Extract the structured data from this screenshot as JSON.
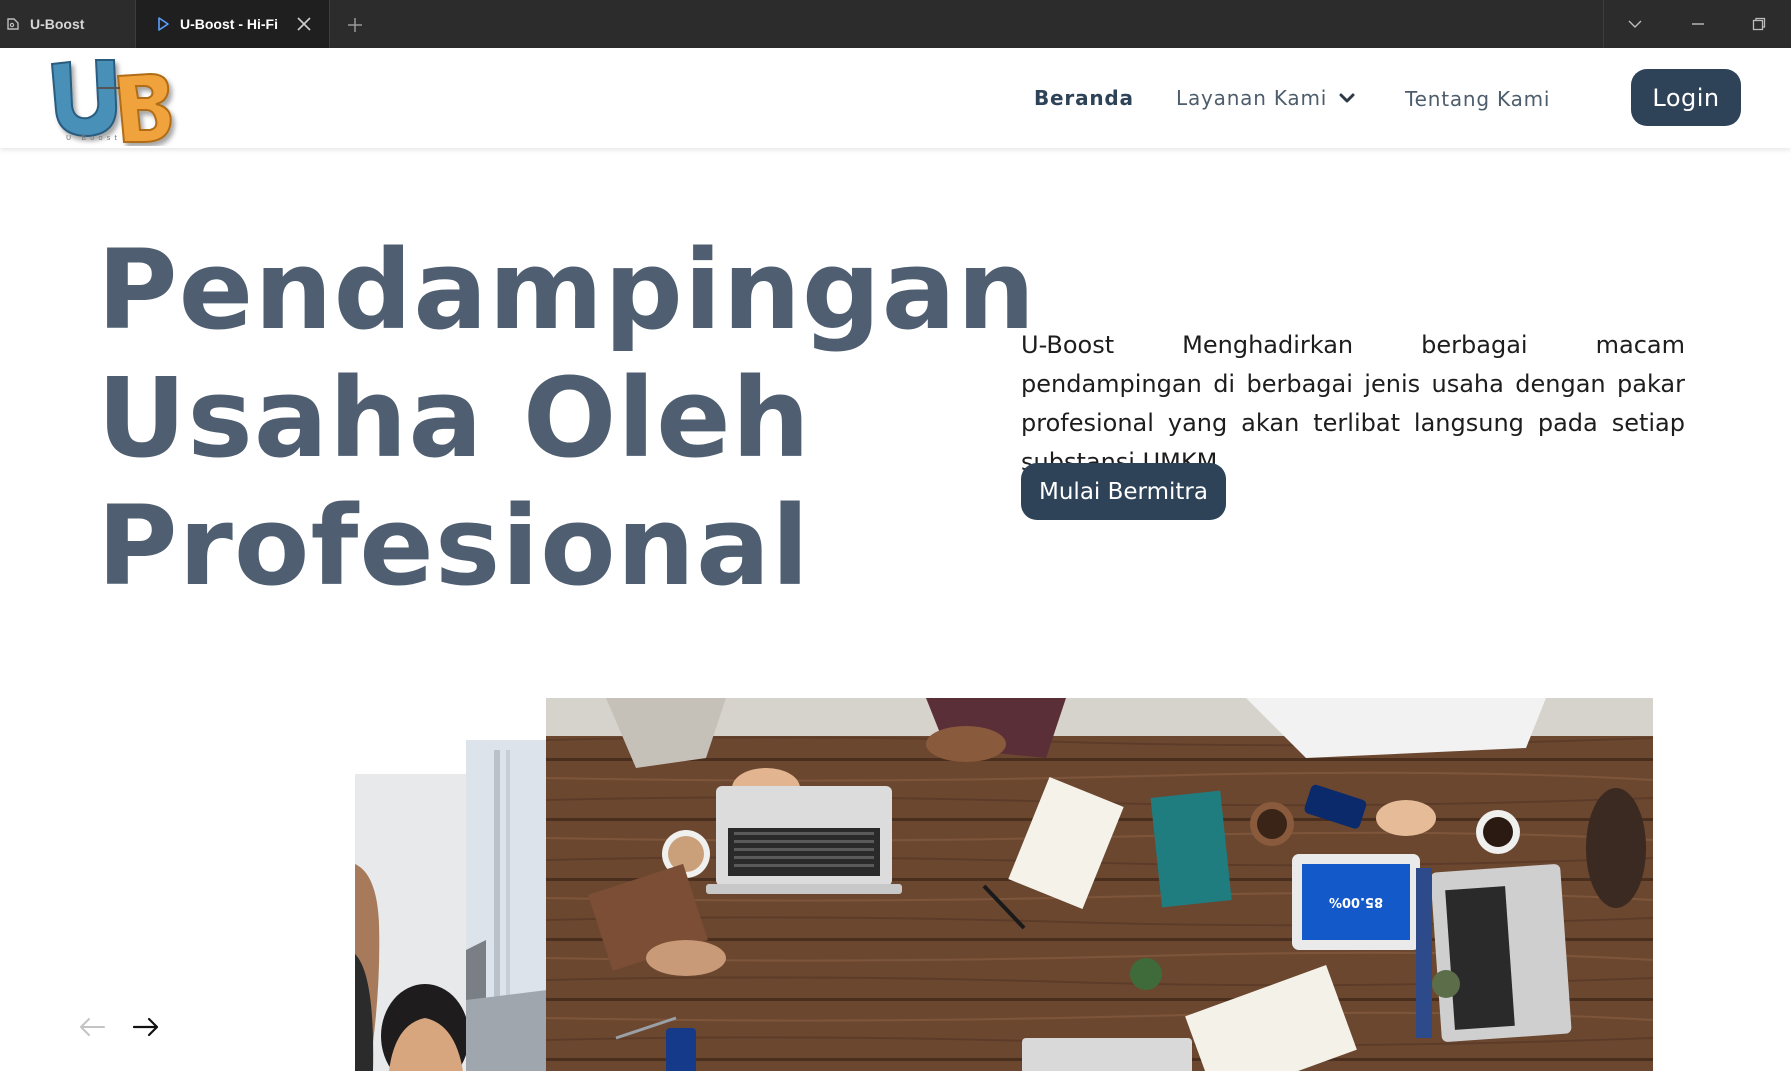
{
  "browser": {
    "tabs": [
      {
        "label": "U-Boost",
        "icon": "figma-file-icon",
        "active": false
      },
      {
        "label": "U-Boost - Hi-Fi",
        "icon": "play-prototype-icon",
        "active": true
      }
    ],
    "controls": [
      "chevron-down-icon",
      "minimize-icon",
      "restore-icon"
    ]
  },
  "logo": {
    "letters": "UB",
    "subtext": "U-Boost",
    "colors": {
      "u": "#4a90b8",
      "b": "#f0a23c"
    }
  },
  "nav": {
    "home": "Beranda",
    "services": "Layanan Kami",
    "about": "Tentang Kami",
    "login": "Login"
  },
  "hero": {
    "title_lines": [
      "Pendampingan",
      "Usaha Oleh",
      "Profesional"
    ],
    "description": "U-Boost Menghadirkan berbagai macam pendampingan di berbagai jenis usaha dengan pakar profesional yang akan terlibat langsung pada setiap substansi UMKM",
    "cta": "Mulai Bermitra"
  },
  "carousel": {
    "main_tablet_text": "85.00%",
    "prev_icon": "arrow-left-icon",
    "next_icon": "arrow-right-icon"
  },
  "colors": {
    "primary": "#2f4358",
    "title": "#4f5f71",
    "tabbar": "#2c2c2c"
  }
}
